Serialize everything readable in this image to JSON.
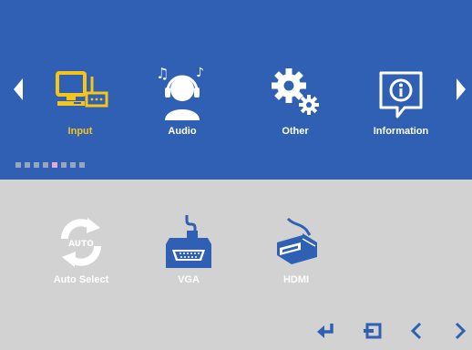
{
  "menu": {
    "items": [
      {
        "label": "Input",
        "icon": "monitor-input-icon",
        "active": true
      },
      {
        "label": "Audio",
        "icon": "headphones-person-icon",
        "active": false
      },
      {
        "label": "Other",
        "icon": "gears-icon",
        "active": false
      },
      {
        "label": "Information",
        "icon": "info-icon",
        "active": false
      }
    ],
    "active_color": "#f5c518",
    "page_dots": 8,
    "active_dot": 5
  },
  "submenu": {
    "items": [
      {
        "label": "Auto Select",
        "icon": "auto-select-icon",
        "badge": "AUTO"
      },
      {
        "label": "VGA",
        "icon": "vga-connector-icon"
      },
      {
        "label": "HDMI",
        "icon": "hdmi-connector-icon"
      }
    ]
  },
  "colors": {
    "top_background": "#2f60b3",
    "bottom_background": "#d2d2d2",
    "button_color": "#2f60b3"
  },
  "controls": [
    "enter-icon",
    "exit-icon",
    "chevron-left-icon",
    "chevron-right-icon"
  ]
}
